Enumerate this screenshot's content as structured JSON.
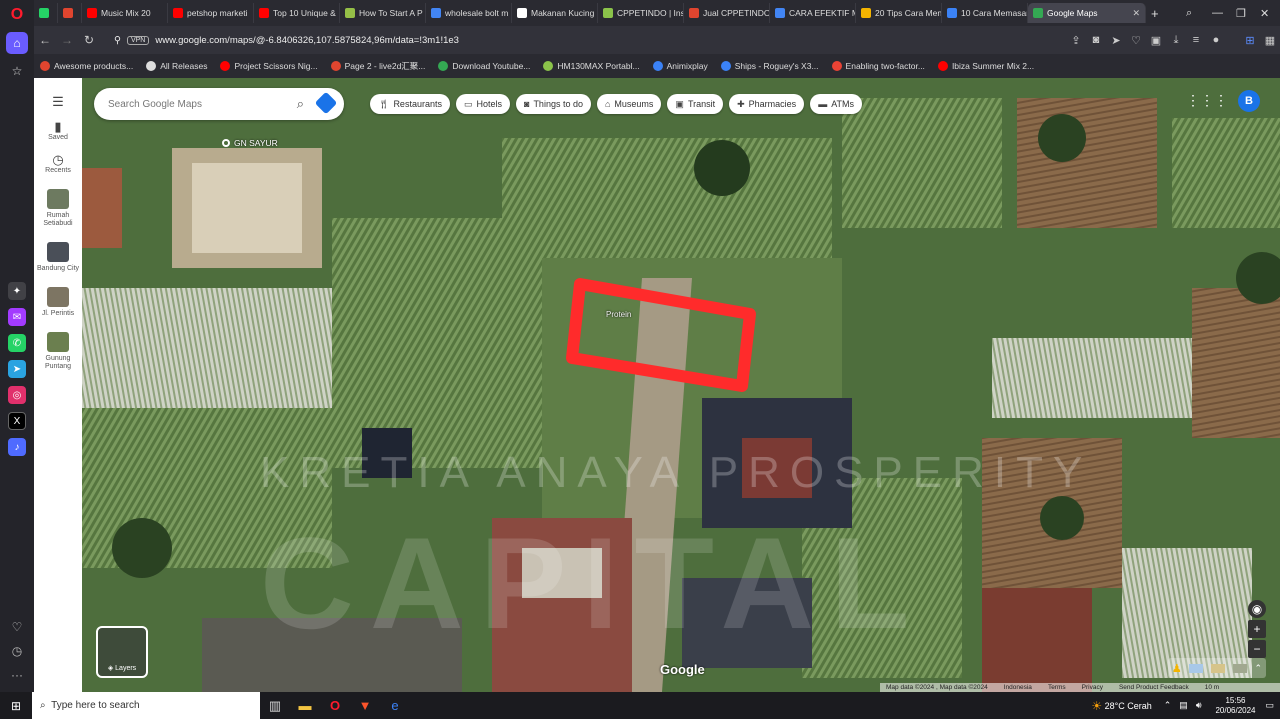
{
  "colors": {
    "accent": "#1a73e8",
    "opera_red": "#ff1b2d",
    "marker": "#ff2b2b"
  },
  "browser": {
    "tabs": [
      {
        "label": "",
        "icon": "whatsapp-icon",
        "color": "#25d366"
      },
      {
        "label": "",
        "icon": "shop-icon",
        "color": "#e0452f"
      },
      {
        "label": "Music Mix 20",
        "icon": "youtube-icon",
        "color": "#ff0000"
      },
      {
        "label": "petshop marketi",
        "icon": "youtube-icon",
        "color": "#ff0000"
      },
      {
        "label": "Top 10 Unique &",
        "icon": "youtube-icon",
        "color": "#ff0000"
      },
      {
        "label": "How To Start A P",
        "icon": "shopify-icon",
        "color": "#95bf47"
      },
      {
        "label": "wholesale bolt m",
        "icon": "google-icon",
        "color": "#4285f4"
      },
      {
        "label": "Makanan Kucing",
        "icon": "site-icon",
        "color": "#ffffff"
      },
      {
        "label": "CPPETINDO | Inst",
        "icon": "leaf-icon",
        "color": "#8bc34a"
      },
      {
        "label": "Jual CPPETINDO",
        "icon": "shop-icon",
        "color": "#e0452f"
      },
      {
        "label": "CARA EFEKTIF M",
        "icon": "google-icon",
        "color": "#4285f4"
      },
      {
        "label": "20 Tips Cara Men",
        "icon": "blog-icon",
        "color": "#f4b400"
      },
      {
        "label": "10 Cara Memasar",
        "icon": "s-icon",
        "color": "#3b82f6"
      },
      {
        "label": "Google Maps",
        "icon": "maps-icon",
        "color": "#34a853",
        "active": true
      }
    ],
    "new_tab": "+",
    "url": "www.google.com/maps/@-6.8406326,107.5875824,96m/data=!3m1!1e3",
    "vpn_label": "VPN",
    "bookmarks": [
      {
        "label": "Awesome products...",
        "color": "#e0452f"
      },
      {
        "label": "All Releases",
        "color": "#dddddd"
      },
      {
        "label": "Project Scissors Nig...",
        "color": "#ff0000"
      },
      {
        "label": "Page 2 - live2d汇聚...",
        "color": "#e0452f"
      },
      {
        "label": "Download Youtube...",
        "color": "#34a853"
      },
      {
        "label": "HM130MAX Portabl...",
        "color": "#8bc34a"
      },
      {
        "label": "Animixplay",
        "color": "#3b82f6"
      },
      {
        "label": "Ships - Roguey's X3...",
        "color": "#3b82f6"
      },
      {
        "label": "Enabling two-factor...",
        "color": "#ea4335"
      },
      {
        "label": "Ibiza Summer Mix 2...",
        "color": "#ff0000"
      }
    ]
  },
  "maps": {
    "search_placeholder": "Search Google Maps",
    "chips": [
      {
        "label": "Restaurants",
        "icon": "fork-knife-icon"
      },
      {
        "label": "Hotels",
        "icon": "bed-icon"
      },
      {
        "label": "Things to do",
        "icon": "camera-icon"
      },
      {
        "label": "Museums",
        "icon": "museum-icon"
      },
      {
        "label": "Transit",
        "icon": "bus-icon"
      },
      {
        "label": "Pharmacies",
        "icon": "pharmacy-icon"
      },
      {
        "label": "ATMs",
        "icon": "atm-icon"
      }
    ],
    "account_initial": "B",
    "sidebar": {
      "saved": "Saved",
      "recents": "Recents",
      "recent_places": [
        "Rumah Setiabudi",
        "Bandung City",
        "Jl. Perintis",
        "Gunung Puntang"
      ]
    },
    "layers_label": "Layers",
    "google_logo": "Google",
    "place_labels": {
      "gn_sayur": "GN SAYUR",
      "prot": "Protein"
    },
    "watermark_line1": "KRETIA ANAYA PROSPERITY",
    "watermark_line2": "CAPITAL",
    "attribution": [
      "Map data ©2024 , Map data ©2024",
      "Indonesia",
      "Terms",
      "Privacy",
      "Send Product Feedback",
      "10 m"
    ]
  },
  "taskbar": {
    "search_placeholder": "Type here to search",
    "weather": "28°C Cerah",
    "time": "15:56",
    "date": "20/06/2024"
  }
}
